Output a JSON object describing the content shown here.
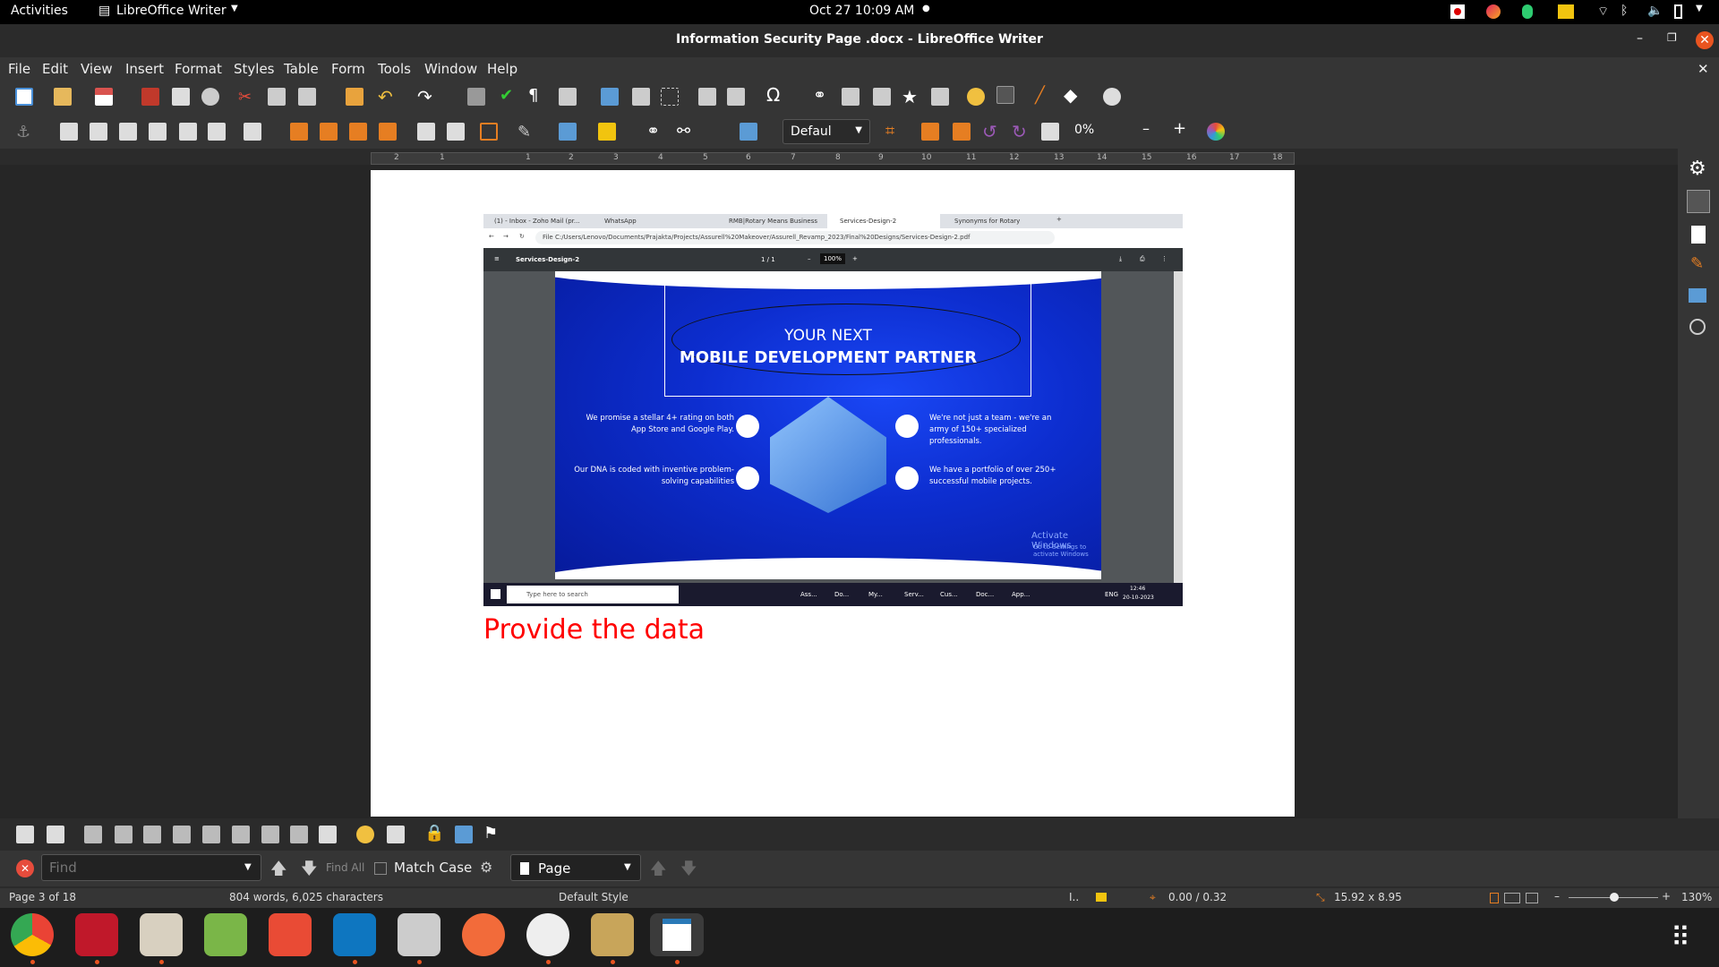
{
  "topbar": {
    "activities": "Activities",
    "app_name": "LibreOffice Writer",
    "datetime": "Oct 27  10:09 AM"
  },
  "window": {
    "title": "Information Security Page .docx - LibreOffice Writer"
  },
  "menu": [
    "File",
    "Edit",
    "View",
    "Insert",
    "Format",
    "Styles",
    "Table",
    "Form",
    "Tools",
    "Window",
    "Help"
  ],
  "toolbar2": {
    "image_mode": "Defaul",
    "transparency": "0%"
  },
  "ruler_ticks": [
    "2",
    "1",
    "1",
    "2",
    "3",
    "4",
    "5",
    "6",
    "7",
    "8",
    "9",
    "10",
    "11",
    "12",
    "13",
    "14",
    "15",
    "16",
    "17",
    "18"
  ],
  "embedded": {
    "tabs": [
      "(1) - Inbox - Zoho Mail (pr...",
      "WhatsApp",
      "RMB|Rotary Means Business",
      "Services-Design-2",
      "Synonyms for Rotary"
    ],
    "address": "C:/Users/Lenovo/Documents/Prajakta/Projects/Assurell%20Makeover/Assurell_Revamp_2023/Final%20Designs/Services-Design-2.pdf",
    "address_prefix": "File",
    "pdf_title": "Services-Design-2",
    "page_indicator": "1 / 1",
    "zoom": "100%",
    "headline_small": "YOUR NEXT",
    "headline_big": "MOBILE DEVELOPMENT PARTNER",
    "features": [
      "We promise a stellar 4+ rating on both App Store and Google Play.",
      "Our DNA is coded with inventive problem-solving capabilities",
      "We're not just a team - we're an army of 150+ specialized professionals.",
      "We have a portfolio of over 250+ successful mobile projects."
    ],
    "watermark": "Activate Windows",
    "watermark_sub": "Go to Settings to activate Windows",
    "taskbar_search": "Type here to search",
    "taskbar_items": [
      "Ass...",
      "Do...",
      "My...",
      "Serv...",
      "Cus...",
      "Doc...",
      "App..."
    ],
    "taskbar_lang": "ENG",
    "taskbar_time": "12:46",
    "taskbar_date": "20-10-2023"
  },
  "doc_text": "Provide the data",
  "findbar": {
    "placeholder": "Find",
    "find_all": "Find All",
    "match_case": "Match Case",
    "nav_target": "Page"
  },
  "status": {
    "page": "Page 3 of 18",
    "words": "804 words, 6,025 characters",
    "style": "Default Style",
    "position": "0.00 / 0.32",
    "size": "15.92 x 8.95",
    "zoom": "130%"
  },
  "colors": {
    "accent": "#e95420",
    "doc_text": "#ff0000",
    "banner": "#1133cc"
  }
}
